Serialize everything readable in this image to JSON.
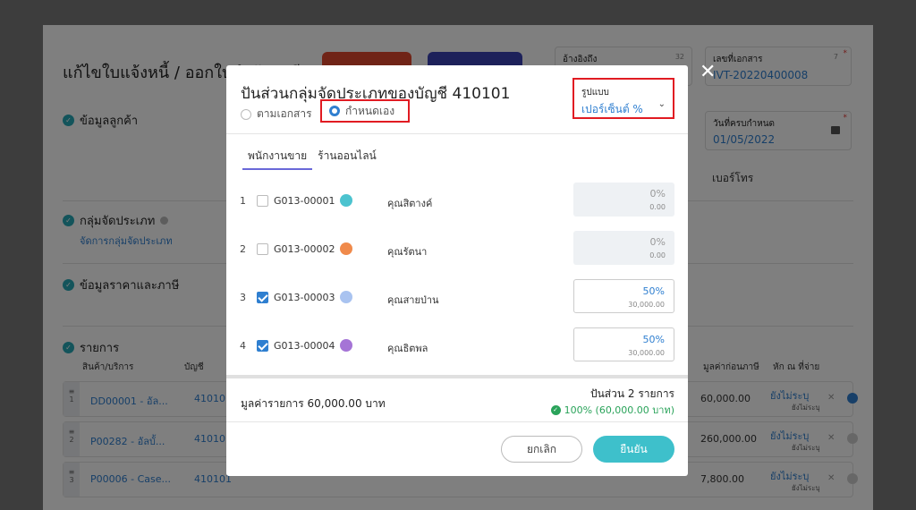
{
  "background": {
    "page_title": "แก้ไขใบแจ้งหนี้ / ออกใบกำกับภาษี",
    "reference": {
      "label": "อ้างอิงถึง",
      "count": "32"
    },
    "doc_number": {
      "label": "เลขที่เอกสาร",
      "value": "IVT-20220400008",
      "count": "7"
    },
    "due_date": {
      "label": "วันที่ครบกำหนด",
      "value": "01/05/2022"
    },
    "phone_label": "เบอร์โทร",
    "sections": {
      "customer": "ข้อมูลลูกค้า",
      "group": "กลุ่มจัดประเภท",
      "group_link": "จัดการกลุ่มจัดประเภท",
      "price_tax": "ข้อมูลราคาและภาษี",
      "items": "รายการ"
    },
    "columns": {
      "product": "สินค้า/บริการ",
      "account": "บัญชี",
      "pre_tax": "มูลค่าก่อนภาษี",
      "withholding": "หัก ณ ที่จ่าย"
    },
    "rows": [
      {
        "num": "1",
        "code": "DD00001 - อัล...",
        "account": "410101",
        "amount": "60,000.00",
        "tax": "ยังไม่ระบุ",
        "tax_sub": "ยังไม่ระบุ"
      },
      {
        "num": "2",
        "code": "P00282 - อัลบั้...",
        "account": "410101",
        "amount": "260,000.00",
        "tax": "ยังไม่ระบุ",
        "tax_sub": "ยังไม่ระบุ"
      },
      {
        "num": "3",
        "code": "P00006 - Case...",
        "account": "410101",
        "amount": "7,800.00",
        "tax": "ยังไม่ระบุ",
        "tax_sub": "ยังไม่ระบุ"
      }
    ]
  },
  "modal": {
    "title": "ปันส่วนกลุ่มจัดประเภทของบัญชี 410101",
    "radio_by_doc": "ตามเอกสาร",
    "radio_custom": "กำหนดเอง",
    "format_label": "รูปแบบ",
    "format_value": "เปอร์เซ็นต์ %",
    "tabs": [
      "พนักงานขาย",
      "ร้านออนไลน์"
    ],
    "items": [
      {
        "num": "1",
        "code": "G013-00001",
        "name": "คุณสิตางค์",
        "pct": "0%",
        "amount": "0.00",
        "checked": false,
        "avatar_color": "#4cc3cf"
      },
      {
        "num": "2",
        "code": "G013-00002",
        "name": "คุณรัตนา",
        "pct": "0%",
        "amount": "0.00",
        "checked": false,
        "avatar_color": "#f08a4b"
      },
      {
        "num": "3",
        "code": "G013-00003",
        "name": "คุณสายป่าน",
        "pct": "50%",
        "amount": "30,000.00",
        "checked": true,
        "avatar_color": "#a9c3f0"
      },
      {
        "num": "4",
        "code": "G013-00004",
        "name": "คุณธิตพล",
        "pct": "50%",
        "amount": "30,000.00",
        "checked": true,
        "avatar_color": "#a574d6"
      }
    ],
    "total_label": "มูลค่ารายการ 60,000.00 บาท",
    "share_label": "ปันส่วน 2 รายการ",
    "share_ok": "100% (60,000.00 บาท)",
    "cancel_label": "ยกเลิก",
    "confirm_label": "ยืนยัน"
  },
  "colors": {
    "accent": "#2f7fd0",
    "confirm": "#3ec0cb",
    "highlight": "#e11b22",
    "success": "#2aa35a"
  }
}
